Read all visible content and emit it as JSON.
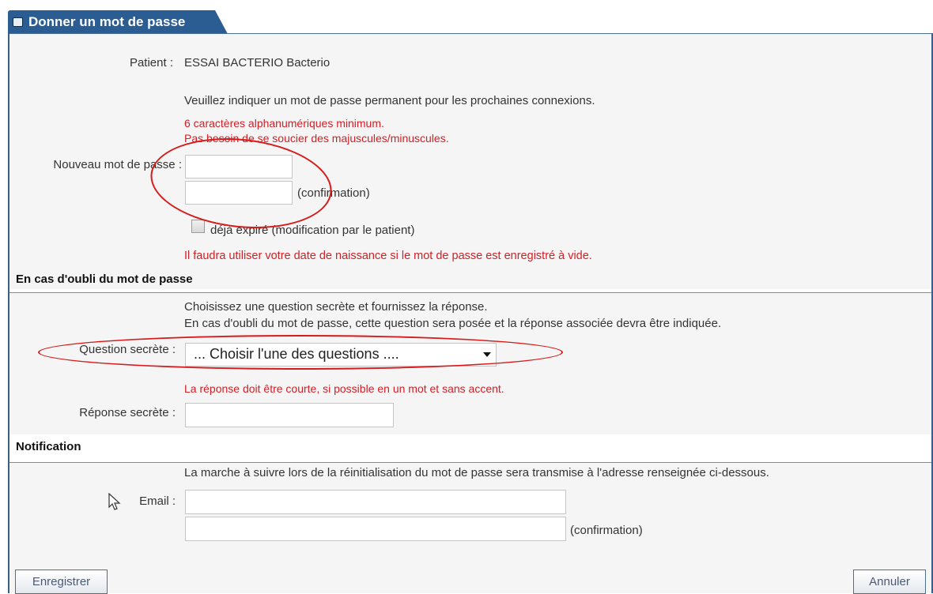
{
  "window": {
    "title": "Donner un mot de passe"
  },
  "patient": {
    "label": "Patient :",
    "value": "ESSAI BACTERIO Bacterio"
  },
  "password_section": {
    "instruction": "Veuillez indiquer un mot de passe permanent pour les prochaines connexions.",
    "hint_line1": "6 caractères alphanumériques minimum.",
    "hint_line2": "Pas besoin de se soucier des majuscules/minuscules.",
    "new_password_label": "Nouveau mot de passe :",
    "new_password_value": "",
    "confirm_value": "",
    "confirm_label": "(confirmation)",
    "expired_checkbox_label": "déjà expiré (modification par le patient)",
    "warning": "Il faudra utiliser votre date de naissance si le mot de passe est enregistré à vide."
  },
  "forgot_section": {
    "heading": "En cas d'oubli du mot de passe",
    "instruction_line1": "Choisissez une question secrète et fournissez la réponse.",
    "instruction_line2": "En cas d'oubli du mot de passe, cette question sera posée et la réponse associée devra être indiquée.",
    "question_label": "Question secrète :",
    "question_selected": "... Choisir l'une des questions ....",
    "answer_hint": "La réponse doit être courte, si possible en un mot et sans accent.",
    "answer_label": "Réponse secrète :",
    "answer_value": ""
  },
  "notification_section": {
    "heading": "Notification",
    "instruction": "La marche à suivre lors de la réinitialisation du mot de passe sera transmise à l'adresse renseignée ci-dessous.",
    "email_label": "Email :",
    "email_value": "",
    "email_confirm_value": "",
    "email_confirm_label": "(confirmation)"
  },
  "buttons": {
    "save": "Enregistrer",
    "cancel": "Annuler"
  },
  "colors": {
    "accent": "#2b5d93",
    "warning_red": "#d12026",
    "annotation_red": "#d71a1a"
  },
  "icons": {
    "title_icon": "window-icon",
    "cursor": "mouse-pointer-icon",
    "select_arrow": "chevron-down-icon"
  }
}
